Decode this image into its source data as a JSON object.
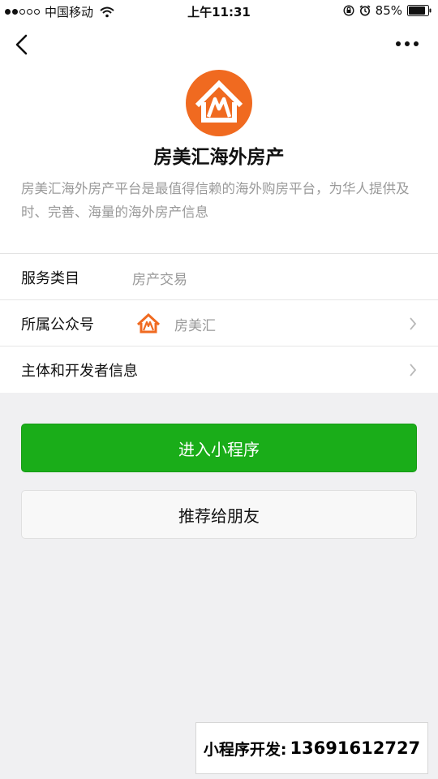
{
  "status_bar": {
    "carrier": "中国移动",
    "time": "上午11:31",
    "battery": "85%",
    "signal_icons": [
      "signal-dots-icon",
      "wifi-icon"
    ],
    "right_icons": [
      "rotation-lock-icon",
      "alarm-icon",
      "battery-icon"
    ]
  },
  "nav": {
    "back_icon": "chevron-left-icon",
    "more_icon": "more-dots-icon"
  },
  "header": {
    "app_name": "房美汇海外房产",
    "description": "房美汇海外房产平台是最值得信赖的海外购房平台，为华人提供及时、完善、海量的海外房产信息",
    "logo_icon": "house-logo-icon"
  },
  "info": {
    "rows": [
      {
        "label": "服务类目",
        "value": "房产交易"
      },
      {
        "label": "所属公众号",
        "value": "房美汇"
      },
      {
        "label": "主体和开发者信息",
        "value": ""
      }
    ]
  },
  "actions": {
    "enter_label": "进入小程序",
    "share_label": "推荐给朋友"
  },
  "contact": {
    "label": "小程序开发:",
    "phone": "13691612727"
  },
  "colors": {
    "primary_green": "#1aad19",
    "logo_orange": "#f06a20",
    "desc_gray": "#9a9a9a"
  }
}
